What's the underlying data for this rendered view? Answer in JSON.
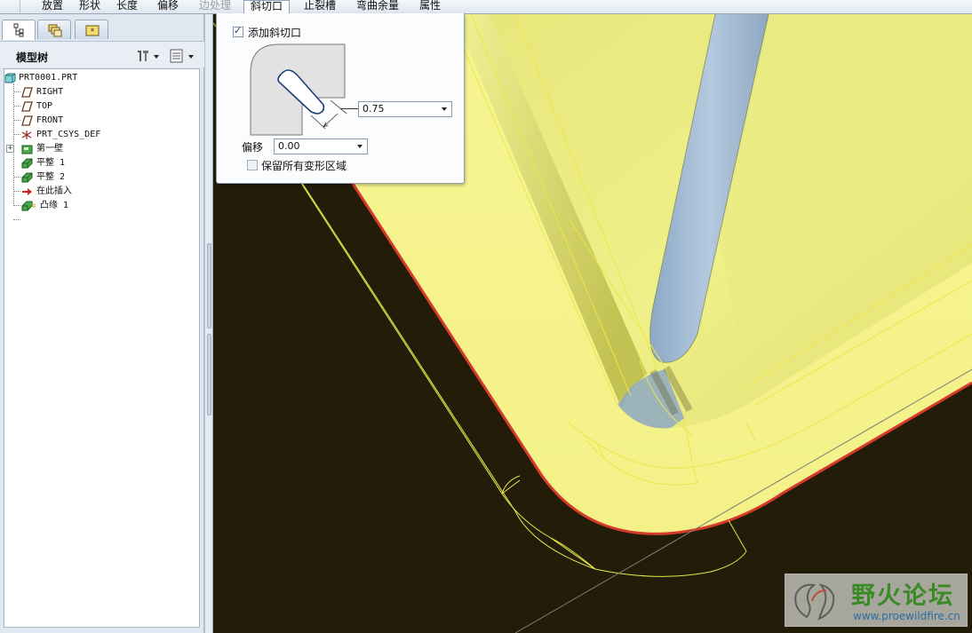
{
  "tabbar": {
    "tabs": [
      {
        "label": "放置",
        "state": "normal"
      },
      {
        "label": "形状",
        "state": "normal"
      },
      {
        "label": "长度",
        "state": "normal"
      },
      {
        "label": "偏移",
        "state": "normal"
      },
      {
        "label": "边处理",
        "state": "disabled"
      },
      {
        "label": "斜切口",
        "state": "active"
      },
      {
        "label": "止裂槽",
        "state": "normal"
      },
      {
        "label": "弯曲余量",
        "state": "normal"
      },
      {
        "label": "属性",
        "state": "normal"
      }
    ]
  },
  "panel": {
    "tab_icons": [
      "model-tree-icon",
      "layers-icon",
      "favorites-icon"
    ],
    "tree_title": "模型树",
    "tool_icons": [
      "tree-settings-icon",
      "tree-columns-icon"
    ]
  },
  "tree": {
    "items": [
      {
        "label": "PRT0001.PRT",
        "icon": "part-icon"
      },
      {
        "label": "RIGHT",
        "icon": "datum-plane-icon"
      },
      {
        "label": "TOP",
        "icon": "datum-plane-icon"
      },
      {
        "label": "FRONT",
        "icon": "datum-plane-icon"
      },
      {
        "label": "PRT_CSYS_DEF",
        "icon": "coordinate-system-icon"
      },
      {
        "label": "第一壁",
        "icon": "first-wall-icon"
      },
      {
        "label": "平整 1",
        "icon": "flat-wall-icon"
      },
      {
        "label": "平整 2",
        "icon": "flat-wall-icon"
      },
      {
        "label": "在此插入",
        "icon": "insert-here-arrow-icon"
      },
      {
        "label": "凸缘 1",
        "icon": "flange-wall-icon"
      }
    ]
  },
  "dialog": {
    "add_miter_label": "添加斜切口",
    "add_miter_checked": true,
    "width_value": "0.75",
    "offset_label": "偏移",
    "offset_value": "0.00",
    "keep_deform_label": "保留所有变形区域",
    "keep_deform_checked": false
  },
  "watermark": {
    "title": "野火论坛",
    "url": "www.proewildfire.cn"
  },
  "colors": {
    "background": "#231c08",
    "part_yellow": "#f4f28c",
    "edge_red": "#d63a2a",
    "blade_blue": "#9bb6d0"
  }
}
